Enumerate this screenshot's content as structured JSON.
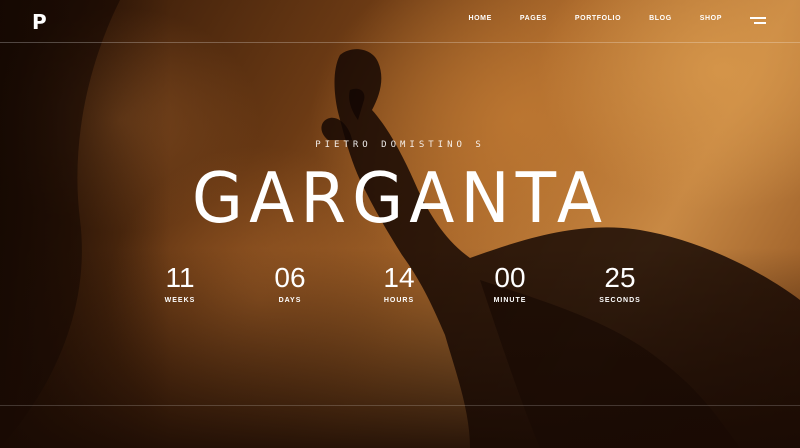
{
  "logo": "P",
  "nav": [
    "HOME",
    "PAGES",
    "PORTFOLIO",
    "BLOG",
    "SHOP"
  ],
  "hero": {
    "subtitle": "PIETRO DOMISTINO S",
    "title": "GARGANTA"
  },
  "countdown": [
    {
      "value": "11",
      "label": "WEEKS"
    },
    {
      "value": "06",
      "label": "DAYS"
    },
    {
      "value": "14",
      "label": "HOURS"
    },
    {
      "value": "00",
      "label": "MINUTE"
    },
    {
      "value": "25",
      "label": "SECONDS"
    }
  ],
  "colors": {
    "accent": "#c98a45",
    "text": "#ffffff",
    "shadow": "#1a0d05"
  }
}
